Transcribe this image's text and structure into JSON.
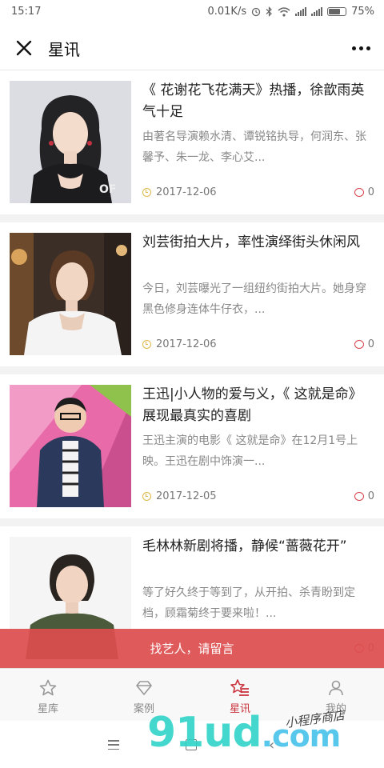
{
  "status_bar": {
    "time": "15:17",
    "network_speed": "0.01K/s",
    "battery_percent": "75%",
    "battery_level": 0.75
  },
  "nav_bar": {
    "title": "星讯",
    "close_icon": "close-icon",
    "more_icon": "more-icon"
  },
  "articles": [
    {
      "title": "《 花谢花飞花满天》热播，徐歆雨英气十足",
      "summary": "由著名导演赖水清、谭锐铭执导，何润东、张馨予、朱一龙、李心艾...",
      "date": "2017-12-06",
      "comments": "0"
    },
    {
      "title": "刘芸街拍大片，率性演绎街头休闲风",
      "summary": "今日，刘芸曝光了一组纽约街拍大片。她身穿黑色修身连体牛仔衣，...",
      "date": "2017-12-06",
      "comments": "0"
    },
    {
      "title": "王迅|小人物的爱与义，《 这就是命》展现最真实的喜剧",
      "summary": "王迅主演的电影《 这就是命》在12月1号上映。王迅在剧中饰演一...",
      "date": "2017-12-05",
      "comments": "0"
    },
    {
      "title": "毛林林新剧将播，静候“蔷薇花开”",
      "summary": "等了好久终于等到了，从开拍、杀青盼到定档，顾霜菊终于要来啦！...",
      "date": "",
      "comments": "0"
    }
  ],
  "banner": {
    "label": "找艺人，请留言"
  },
  "tabs": [
    {
      "label": "星库",
      "icon": "star-icon",
      "active": false
    },
    {
      "label": "案例",
      "icon": "diamond-icon",
      "active": false
    },
    {
      "label": "星讯",
      "icon": "star-list-icon",
      "active": true
    },
    {
      "label": "我的",
      "icon": "person-icon",
      "active": false
    }
  ],
  "watermark": {
    "main": "91ud",
    "suffix": ".com",
    "sub": "小程序商店"
  },
  "colors": {
    "accent": "#c9313a",
    "banner": "#dd4e4e",
    "date_icon": "#e0b84a"
  }
}
